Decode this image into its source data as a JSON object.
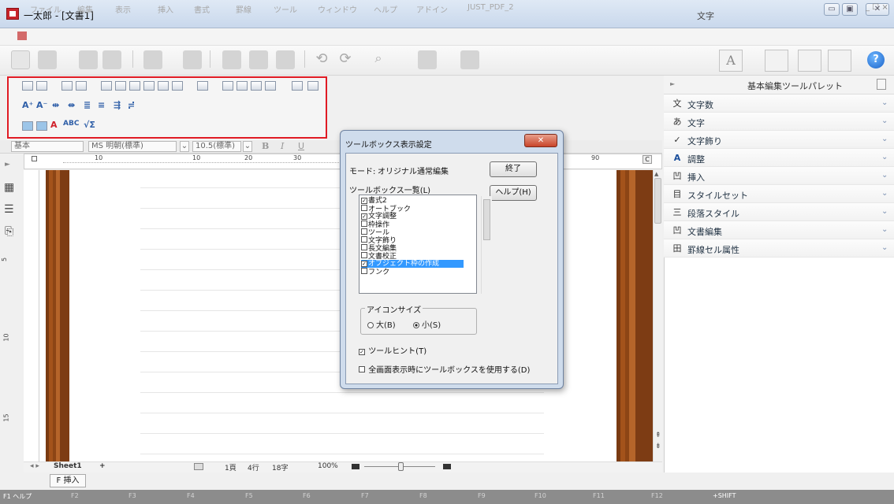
{
  "window": {
    "title": "一太郎 - [文書1]",
    "controls": [
      "▭",
      "▣",
      "✕"
    ]
  },
  "menubar": {
    "items": [
      "ファイル",
      "編集",
      "表示",
      "挿入",
      "書式",
      "罫線",
      "ツール",
      "ウィンドウ",
      "ヘルプ",
      "アドイン",
      "JUST_PDF_2"
    ],
    "right": "_ ☐ ×"
  },
  "toolbar": {
    "moji_label": "文字",
    "help": "?"
  },
  "toolbox": {
    "highlight_color": "#e01b24"
  },
  "format_bar": {
    "style_value": "基本",
    "font_value": "MS 明朝(標準)",
    "size_value": "10.5(標準)",
    "bold": "B",
    "italic": "I",
    "underline": "U"
  },
  "ruler": {
    "numbers": [
      "10",
      "10",
      "20",
      "30",
      "90"
    ],
    "corner": "C"
  },
  "vruler": {
    "numbers": [
      "5",
      "10",
      "15"
    ]
  },
  "statusbar": {
    "sheet": "Sheet1",
    "add": "+",
    "page": "1頁",
    "line": "4行",
    "chars": "18字",
    "zoom": "100%"
  },
  "bottombar": {
    "insert": "挿入",
    "insert_key": "F"
  },
  "fkeys": [
    "F1 ヘルプ",
    "F2",
    "F3",
    "F4",
    "F5",
    "F6",
    "F7",
    "F8",
    "F9",
    "F10",
    "F11",
    "F12",
    "+SHIFT"
  ],
  "panel": {
    "title": "基本編集ツールパレット",
    "items": [
      {
        "icon": "文",
        "label": "文字数"
      },
      {
        "icon": "あ",
        "label": "文字"
      },
      {
        "icon": "✓",
        "label": "文字飾り"
      },
      {
        "icon": "A",
        "label": "調整"
      },
      {
        "icon": "凹",
        "label": "挿入"
      },
      {
        "icon": "目",
        "label": "スタイルセット"
      },
      {
        "icon": "三",
        "label": "段落スタイル"
      },
      {
        "icon": "凹",
        "label": "文書編集"
      },
      {
        "icon": "田",
        "label": "罫線セル属性"
      }
    ]
  },
  "dialog": {
    "title": "ツールボックス表示設定",
    "mode_label": "モード:",
    "mode_value": "オリジナル通常編集",
    "close_button": "終了",
    "help_button": "ヘルプ(H)",
    "list_label": "ツールボックス一覧(L)",
    "list_items": [
      {
        "label": "書式2",
        "checked": true
      },
      {
        "label": "オートブック",
        "checked": false
      },
      {
        "label": "文字調整",
        "checked": true
      },
      {
        "label": "枠操作",
        "checked": false
      },
      {
        "label": "ツール",
        "checked": false
      },
      {
        "label": "文字飾り",
        "checked": false
      },
      {
        "label": "長文編集",
        "checked": false
      },
      {
        "label": "文書校正",
        "checked": false
      },
      {
        "label": "オブジェクト枠の作成",
        "checked": true,
        "selected": true
      },
      {
        "label": "フンク",
        "checked": false
      }
    ],
    "icon_size_label": "アイコンサイズ",
    "radio_large": "大(B)",
    "radio_small": "小(S)",
    "tooltip_checkbox": "ツールヒント(T)",
    "fullscreen_checkbox": "全画面表示時にツールボックスを使用する(D)"
  }
}
